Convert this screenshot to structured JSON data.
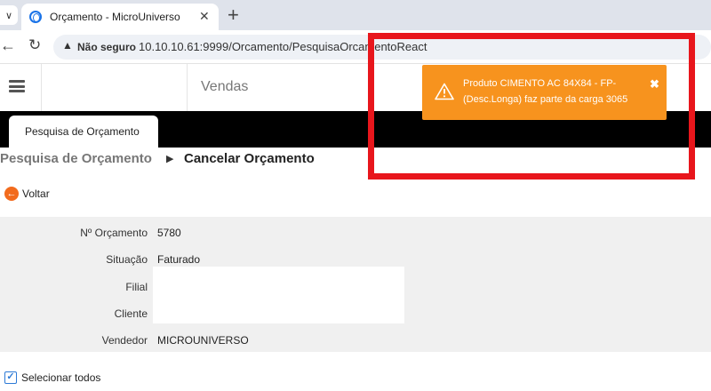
{
  "browser": {
    "tab_title": "Orçamento - MicroUniverso",
    "security_label": "Não seguro",
    "url": "10.10.10.61:9999/Orcamento/PesquisaOrcamentoReact",
    "new_tab_glyph": "+",
    "close_tab_glyph": "✕",
    "back_glyph": "←",
    "reload_glyph": "↻",
    "dropdown_glyph": "∨",
    "warn_glyph": "▲"
  },
  "header": {
    "module_title": "Vendas"
  },
  "page_tab": {
    "label": "Pesquisa de Orçamento"
  },
  "breadcrumb": {
    "parent": "Pesquisa de Orçamento",
    "separator": "▶",
    "current": "Cancelar Orçamento"
  },
  "back_button": {
    "label": "Voltar",
    "icon_glyph": "←"
  },
  "form": {
    "fields": [
      {
        "label": "Nº Orçamento",
        "value": "5780"
      },
      {
        "label": "Situação",
        "value": "Faturado"
      },
      {
        "label": "Filial",
        "value": ""
      },
      {
        "label": "Cliente",
        "value": ""
      },
      {
        "label": "Vendedor",
        "value": "MICROUNIVERSO"
      }
    ]
  },
  "select_all": {
    "label": "Selecionar todos",
    "checked": true,
    "check_glyph": "✓"
  },
  "toast": {
    "message": "Produto CIMENTO AC 84X84 - FP-(Desc.Longa) faz parte da carga 3065",
    "close_glyph": "✖",
    "color": "#f7931e"
  },
  "colors": {
    "highlight": "#e8161c",
    "accent_orange": "#f26b1d",
    "checkbox_blue": "#2d7ad6"
  }
}
